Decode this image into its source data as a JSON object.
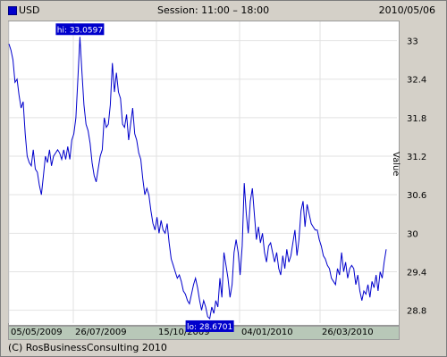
{
  "header": {
    "legend_label": "USD",
    "session": "Session: 11:00 – 18:00",
    "date": "2010/05/06"
  },
  "footer": {
    "copyright": "(C) RosBusinessConsulting 2010"
  },
  "colors": {
    "series": "#0000cc",
    "frame_bg": "#d4d0c8",
    "axis_band": "#b8c8b8",
    "label_bg": "#0000cc"
  },
  "chart_data": {
    "type": "line",
    "series": [
      {
        "name": "USD",
        "values": [
          32.95,
          32.85,
          32.7,
          32.35,
          32.4,
          32.15,
          31.95,
          32.05,
          31.55,
          31.2,
          31.1,
          31.05,
          31.3,
          31.0,
          30.95,
          30.75,
          30.6,
          30.9,
          31.2,
          31.1,
          31.3,
          31.05,
          31.2,
          31.25,
          31.3,
          31.25,
          31.15,
          31.3,
          31.15,
          31.35,
          31.15,
          31.45,
          31.55,
          31.8,
          32.4,
          33.06,
          32.5,
          32.0,
          31.7,
          31.6,
          31.4,
          31.1,
          30.9,
          30.8,
          31.0,
          31.2,
          31.3,
          31.8,
          31.65,
          31.7,
          32.0,
          32.65,
          32.2,
          32.5,
          32.2,
          32.1,
          31.7,
          31.65,
          31.85,
          31.45,
          31.7,
          31.95,
          31.55,
          31.45,
          31.25,
          31.15,
          30.85,
          30.6,
          30.7,
          30.6,
          30.35,
          30.15,
          30.05,
          30.25,
          30.0,
          30.2,
          30.05,
          30.0,
          30.15,
          29.85,
          29.6,
          29.5,
          29.4,
          29.3,
          29.35,
          29.25,
          29.1,
          29.05,
          28.95,
          28.9,
          29.05,
          29.2,
          29.3,
          29.15,
          28.95,
          28.8,
          28.95,
          28.85,
          28.7,
          28.67,
          28.85,
          28.75,
          28.95,
          28.85,
          29.3,
          29.0,
          29.7,
          29.5,
          29.3,
          29.0,
          29.2,
          29.7,
          29.9,
          29.7,
          29.35,
          29.8,
          30.78,
          30.3,
          30.0,
          30.5,
          30.7,
          30.3,
          29.9,
          30.1,
          29.85,
          30.0,
          29.7,
          29.55,
          29.8,
          29.85,
          29.7,
          29.55,
          29.7,
          29.45,
          29.35,
          29.65,
          29.45,
          29.75,
          29.55,
          29.65,
          29.85,
          30.05,
          29.65,
          29.9,
          30.35,
          30.5,
          30.1,
          30.45,
          30.3,
          30.15,
          30.1,
          30.05,
          30.05,
          29.9,
          29.8,
          29.65,
          29.6,
          29.5,
          29.45,
          29.3,
          29.25,
          29.2,
          29.45,
          29.35,
          29.7,
          29.4,
          29.55,
          29.3,
          29.45,
          29.5,
          29.45,
          29.2,
          29.35,
          29.1,
          28.95,
          29.1,
          29.05,
          29.2,
          29.0,
          29.25,
          29.15,
          29.35,
          29.1,
          29.4,
          29.3,
          29.55,
          29.75
        ]
      }
    ],
    "x_tick_labels": [
      "05/05/2009",
      "26/07/2009",
      "15/10/2009",
      "04/01/2010",
      "26/03/2010"
    ],
    "y_tick_labels": [
      "33",
      "32.4",
      "31.8",
      "31.2",
      "30.6",
      "30",
      "29.4",
      "28.8"
    ],
    "y_ticks": [
      33,
      32.4,
      31.8,
      31.2,
      30.6,
      30,
      29.4,
      28.8
    ],
    "ylim": [
      28.6,
      33.3
    ],
    "ylabel": "Value",
    "hi_label": "hi: 33.0597",
    "lo_label": "lo: 28.6701",
    "grid": true
  }
}
